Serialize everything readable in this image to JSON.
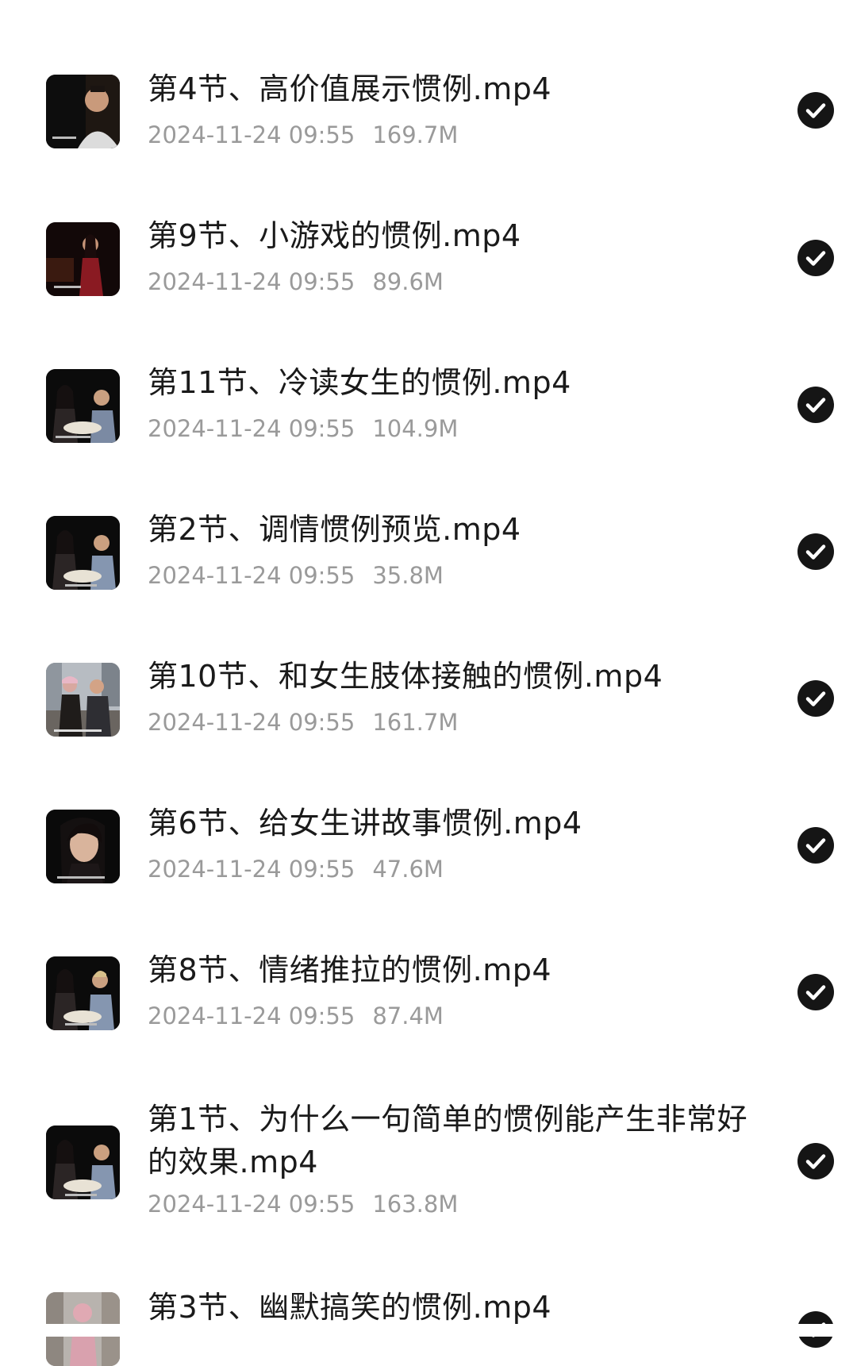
{
  "files": [
    {
      "title": "第4节、高价值展示惯例.mp4",
      "date": "2024-11-24 09:55",
      "size": "169.7M",
      "thumb": "man-dark",
      "checked": true
    },
    {
      "title": "第9节、小游戏的惯例.mp4",
      "date": "2024-11-24 09:55",
      "size": "89.6M",
      "thumb": "woman-red",
      "checked": true
    },
    {
      "title": "第11节、冷读女生的惯例.mp4",
      "date": "2024-11-24 09:55",
      "size": "104.9M",
      "thumb": "two-people-table",
      "checked": true
    },
    {
      "title": "第2节、调情惯例预览.mp4",
      "date": "2024-11-24 09:55",
      "size": "35.8M",
      "thumb": "two-people-table",
      "checked": true
    },
    {
      "title": "第10节、和女生肢体接触的惯例.mp4",
      "date": "2024-11-24 09:55",
      "size": "161.7M",
      "thumb": "outdoor-street",
      "checked": true
    },
    {
      "title": "第6节、给女生讲故事惯例.mp4",
      "date": "2024-11-24 09:55",
      "size": "47.6M",
      "thumb": "woman-closeup",
      "checked": true
    },
    {
      "title": "第8节、情绪推拉的惯例.mp4",
      "date": "2024-11-24 09:55",
      "size": "87.4M",
      "thumb": "two-people-table",
      "checked": true
    },
    {
      "title": "第1节、为什么一句简单的惯例能产生非常好的效果.mp4",
      "date": "2024-11-24 09:55",
      "size": "163.8M",
      "thumb": "two-people-table",
      "checked": true
    },
    {
      "title": "第3节、幽默搞笑的惯例.mp4",
      "date": "",
      "size": "",
      "thumb": "outdoor-pink",
      "checked": true
    }
  ],
  "icons": {
    "check": "checkmark-circle-icon"
  },
  "colors": {
    "title": "#1a1a1a",
    "meta": "#9a9a9a",
    "check_bg": "#151515",
    "background": "#ffffff"
  }
}
